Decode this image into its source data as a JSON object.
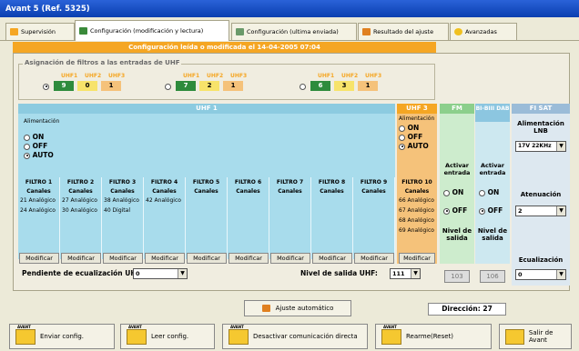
{
  "window": {
    "title": "Avant 5 (Ref. 5325)"
  },
  "tabs": [
    {
      "label": "Supervisión",
      "active": false
    },
    {
      "label": "Configuración (modificación y lectura)",
      "active": true
    },
    {
      "label": "Configuración (ultima enviada)",
      "active": false
    },
    {
      "label": "Resultado del ajuste",
      "active": false
    },
    {
      "label": "Avanzadas",
      "active": false
    }
  ],
  "banner": "Configuración leída o modificada el 14-04-2005 07:04",
  "filters": {
    "title": "Asignación de filtros a las entradas de UHF",
    "groups": [
      {
        "labels": [
          "UHF1",
          "UHF2",
          "UHF3"
        ],
        "values": [
          "9",
          "0",
          "1"
        ],
        "selected": true
      },
      {
        "labels": [
          "UHF1",
          "UHF2",
          "UHF3"
        ],
        "values": [
          "7",
          "2",
          "1"
        ],
        "selected": false
      },
      {
        "labels": [
          "UHF1",
          "UHF2",
          "UHF3"
        ],
        "values": [
          "6",
          "3",
          "1"
        ],
        "selected": false
      }
    ]
  },
  "uhf": {
    "header": "UHF 1",
    "alim_label": "Alimentación",
    "options": [
      "ON",
      "OFF",
      "AUTO"
    ],
    "selected": "AUTO",
    "filters": [
      {
        "title": "FILTRO 1",
        "sub": "Canales",
        "lines": [
          "21 Analógico",
          "24 Analógico"
        ]
      },
      {
        "title": "FILTRO 2",
        "sub": "Canales",
        "lines": [
          "27 Analógico",
          "30 Analógico"
        ]
      },
      {
        "title": "FILTRO 3",
        "sub": "Canales",
        "lines": [
          "38 Analógico",
          "40 Digital"
        ]
      },
      {
        "title": "FILTRO 4",
        "sub": "Canales",
        "lines": [
          "42 Analógico"
        ]
      },
      {
        "title": "FILTRO 5",
        "sub": "Canales",
        "lines": []
      },
      {
        "title": "FILTRO 6",
        "sub": "Canales",
        "lines": []
      },
      {
        "title": "FILTRO 7",
        "sub": "Canales",
        "lines": []
      },
      {
        "title": "FILTRO 8",
        "sub": "Canales",
        "lines": []
      },
      {
        "title": "FILTRO 9",
        "sub": "Canales",
        "lines": []
      }
    ],
    "modify_label": "Modificar",
    "slope_label": "Pendiente de ecualización UHF:",
    "slope_value": "0",
    "output_label": "Nivel de salida UHF:",
    "output_value": "111"
  },
  "uhf3": {
    "header": "UHF 3",
    "alim_label": "Alimentación",
    "options": [
      "ON",
      "OFF",
      "AUTO"
    ],
    "filter": {
      "title": "FILTRO 10",
      "sub": "Canales",
      "lines": [
        "66 Analógico",
        "67 Analógico",
        "68 Analógico",
        "69 Analógico"
      ]
    }
  },
  "fm": {
    "header": "FM",
    "activate": "Activar entrada",
    "options": [
      "ON",
      "OFF"
    ],
    "level_label": "Nivel de salida",
    "level_value": "103"
  },
  "bi": {
    "header": "BI-BIII DAB",
    "activate": "Activar entrada",
    "options": [
      "ON",
      "OFF"
    ],
    "level_label": "Nivel de salida",
    "level_value": "106"
  },
  "fisat": {
    "header": "FI SAT",
    "lnb_label": "Alimentación LNB",
    "lnb_value": "17V 22KHz",
    "att_label": "Atenuación",
    "att_value": "2",
    "eq_label": "Ecualización",
    "eq_value": "0"
  },
  "auto_button": "Ajuste automático",
  "direccion": "Dirección: 27",
  "bottom": [
    {
      "tag": "AVANT",
      "label": "Enviar config."
    },
    {
      "tag": "AVANT",
      "label": "Leer config."
    },
    {
      "tag": "AVANT",
      "label": "Desactivar comunicación directa"
    },
    {
      "tag": "AVANT",
      "label": "Rearme(Reset)"
    },
    {
      "tag": "",
      "label": "Salir de Avant"
    }
  ]
}
